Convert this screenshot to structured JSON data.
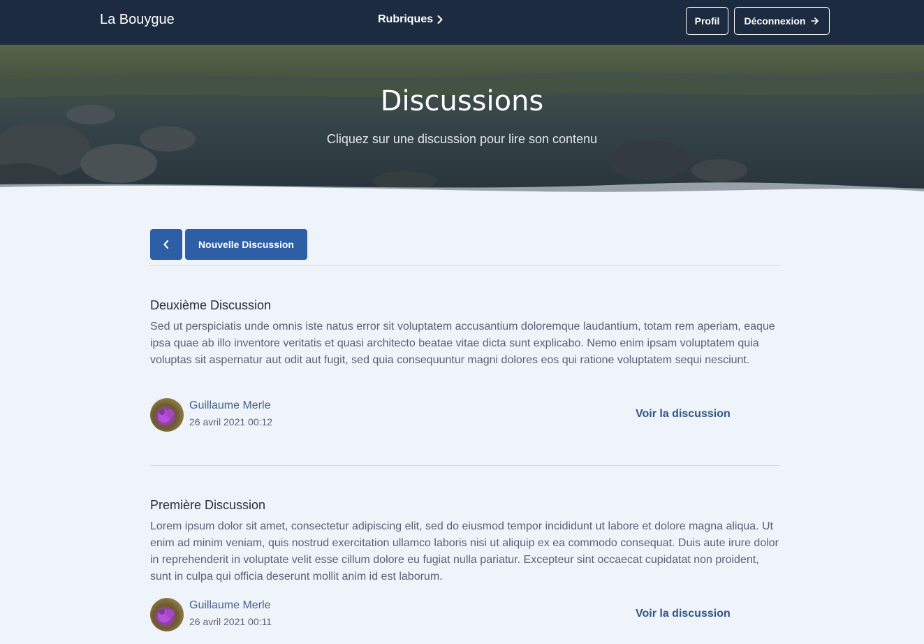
{
  "navbar": {
    "brand": "La Bouygue",
    "rubriques_label": "Rubriques",
    "profil_label": "Profil",
    "logout_label": "Déconnexion"
  },
  "hero": {
    "title": "Discussions",
    "subtitle": "Cliquez sur une discussion pour lire son contenu"
  },
  "toolbar": {
    "new_discussion_label": "Nouvelle Discussion"
  },
  "discussions": [
    {
      "title": "Deuxième Discussion",
      "body": "Sed ut perspiciatis unde omnis iste natus error sit voluptatem accusantium doloremque laudantium, totam rem aperiam, eaque ipsa quae ab illo inventore veritatis et quasi architecto beatae vitae dicta sunt explicabo. Nemo enim ipsam voluptatem quia voluptas sit aspernatur aut odit aut fugit, sed quia consequuntur magni dolores eos qui ratione voluptatem sequi nesciunt.",
      "author": "Guillaume Merle",
      "date": "26 avril 2021 00:12",
      "link_label": "Voir la discussion"
    },
    {
      "title": "Première Discussion",
      "body": "Lorem ipsum dolor sit amet, consectetur adipiscing elit, sed do eiusmod tempor incididunt ut labore et dolore magna aliqua. Ut enim ad minim veniam, quis nostrud exercitation ullamco laboris nisi ut aliquip ex ea commodo consequat. Duis aute irure dolor in reprehenderit in voluptate velit esse cillum dolore eu fugiat nulla pariatur. Excepteur sint occaecat cupidatat non proident, sunt in culpa qui officia deserunt mollit anim id est laborum.",
      "author": "Guillaume Merle",
      "date": "26 avril 2021 00:11",
      "link_label": "Voir la discussion"
    }
  ],
  "colors": {
    "navbar_bg": "#1d2b41",
    "primary": "#2d5ea6",
    "link": "#2f5687",
    "page_bg": "#eff3fa"
  },
  "icons": {
    "rubriques": "chevron-right-icon",
    "logout": "arrow-right-icon",
    "back": "chevron-left-icon"
  }
}
